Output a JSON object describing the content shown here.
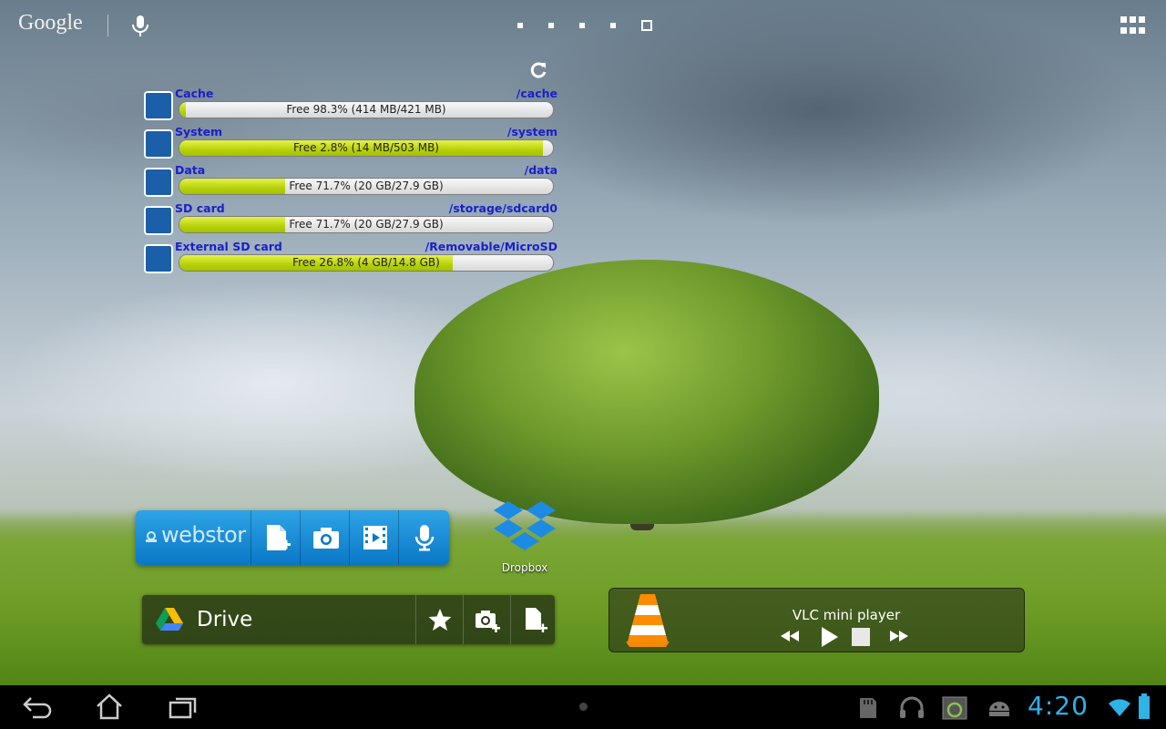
{
  "top_bar": {
    "search_label": "Google",
    "page_count": 5,
    "active_page": 5
  },
  "storage_widget": {
    "rows": [
      {
        "name": "Cache",
        "path": "/cache",
        "bar_text": "Free 98.3% (414 MB/421 MB)",
        "free_fraction": 0.983,
        "icon": "cache-icon"
      },
      {
        "name": "System",
        "path": "/system",
        "bar_text": "Free 2.8% (14 MB/503 MB)",
        "free_fraction": 0.028,
        "icon": "system-icon"
      },
      {
        "name": "Data",
        "path": "/data",
        "bar_text": "Free 71.7% (20 GB/27.9 GB)",
        "free_fraction": 0.717,
        "icon": "data-icon"
      },
      {
        "name": "SD card",
        "path": "/storage/sdcard0",
        "bar_text": "Free 71.7% (20 GB/27.9 GB)",
        "free_fraction": 0.717,
        "icon": "sd-card-icon"
      },
      {
        "name": "External SD card",
        "path": "/Removable/MicroSD",
        "bar_text": "Free 26.8% (4 GB/14.8 GB)",
        "free_fraction": 0.268,
        "icon": "floppy-icon"
      }
    ]
  },
  "webstor": {
    "logo_text": "webstor"
  },
  "dropbox": {
    "label": "Dropbox"
  },
  "drive": {
    "label": "Drive"
  },
  "vlc": {
    "title": "VLC mini player"
  },
  "nav_bar": {
    "clock": "4:20"
  },
  "colors": {
    "storage_label": "#1a1fc8",
    "bar_fill": "#b7d10a",
    "clock": "#2fb2e6",
    "webstor_bg": "#0a78c6"
  }
}
